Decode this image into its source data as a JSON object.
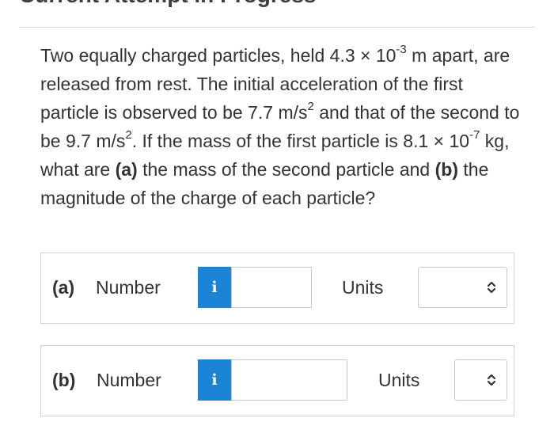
{
  "page": {
    "heading": "Current Attempt in Progress"
  },
  "question": {
    "part1": "Two equally charged particles, held 4.3 × 10",
    "exp1": "-3",
    "part2": " m apart, are released from rest. The initial acceleration of the first particle is observed to be 7.7 m/s",
    "exp2": "2",
    "part3": " and that of the second to be 9.7 m/s",
    "exp3": "2",
    "part4": ". If the mass of the first particle is 8.1 × 10",
    "exp4": "-7",
    "part5": " kg, what are ",
    "bold_a": "(a)",
    "part6": " the mass of the second particle and ",
    "bold_b": "(b)",
    "part7": " the magnitude of the charge of each particle?"
  },
  "answers": [
    {
      "part_label": "(a)",
      "number_label": "Number",
      "info_label": "i",
      "number_value": "",
      "units_label": "Units",
      "units_value": ""
    },
    {
      "part_label": "(b)",
      "number_label": "Number",
      "info_label": "i",
      "number_value": "",
      "units_label": "Units",
      "units_value": ""
    }
  ],
  "colors": {
    "info_button": "#1b84d4",
    "text": "#333333",
    "border": "#d0d0d0"
  },
  "icons": {
    "info": "info-icon",
    "select": "chevron-up-down-icon"
  }
}
